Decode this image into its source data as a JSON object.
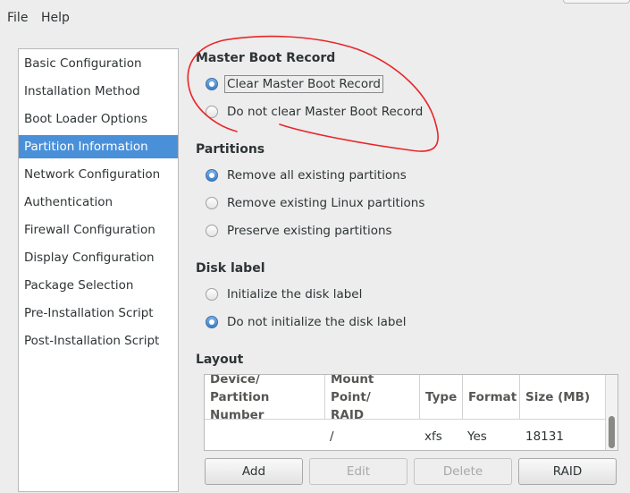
{
  "menu": {
    "file": "File",
    "help": "Help"
  },
  "sidebar": {
    "items": [
      {
        "label": "Basic Configuration"
      },
      {
        "label": "Installation Method"
      },
      {
        "label": "Boot Loader Options"
      },
      {
        "label": "Partition Information"
      },
      {
        "label": "Network Configuration"
      },
      {
        "label": "Authentication"
      },
      {
        "label": "Firewall Configuration"
      },
      {
        "label": "Display Configuration"
      },
      {
        "label": "Package Selection"
      },
      {
        "label": "Pre-Installation Script"
      },
      {
        "label": "Post-Installation Script"
      }
    ],
    "selected": "Partition Information"
  },
  "mbr": {
    "title": "Master Boot Record",
    "options": [
      "Clear Master Boot Record",
      "Do not clear Master Boot Record"
    ],
    "selected": "Clear Master Boot Record"
  },
  "partitions": {
    "title": "Partitions",
    "options": [
      "Remove all existing partitions",
      "Remove existing Linux partitions",
      "Preserve existing partitions"
    ],
    "selected": "Remove all existing partitions"
  },
  "disk_label": {
    "title": "Disk label",
    "options": [
      "Initialize the disk label",
      "Do not initialize the disk label"
    ],
    "selected": "Do not initialize the disk label"
  },
  "layout": {
    "title": "Layout",
    "columns": [
      [
        "Device/",
        "Partition Number"
      ],
      [
        "Mount Point/",
        "RAID"
      ],
      [
        "Type"
      ],
      [
        "Format"
      ],
      [
        "Size (MB)"
      ]
    ],
    "rows": [
      {
        "device": "",
        "mount": "/",
        "type": "xfs",
        "format": "Yes",
        "size": "18131"
      }
    ]
  },
  "buttons": {
    "add": "Add",
    "edit": "Edit",
    "delete": "Delete",
    "raid": "RAID"
  },
  "colors": {
    "selection": "#4a90d9",
    "annotation": "#e8262a"
  }
}
